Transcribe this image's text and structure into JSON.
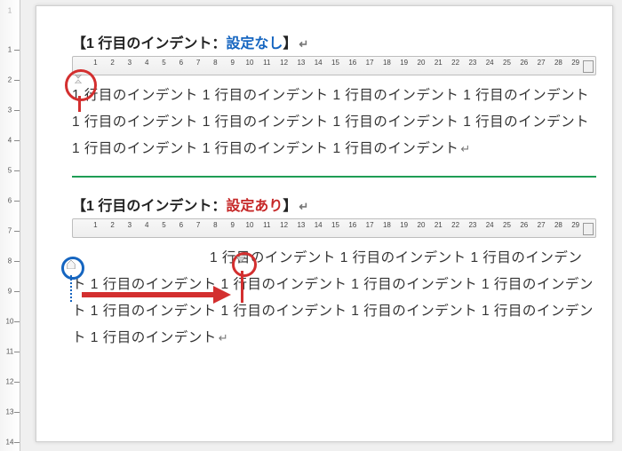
{
  "vertical_ruler": {
    "gray_label": "1",
    "max": 14,
    "spacing_px": 34
  },
  "hruler": {
    "max": 29,
    "spacing_px": 19.3
  },
  "sections": [
    {
      "id": "no-indent",
      "heading_pre": "【1 行目のインデント：",
      "heading_kw": "設定なし",
      "heading_kw_class": "kw-blue",
      "heading_post": "】",
      "return_mark": "↵",
      "body": "1 行目のインデント 1 行目のインデント 1 行目のインデント 1 行目のインデント 1 行目のインデント 1 行目のインデント 1 行目のインデント 1 行目のインデント 1 行目のインデント 1 行目のインデント 1 行目のインデント",
      "indented": false
    },
    {
      "id": "with-indent",
      "heading_pre": "【1 行目のインデント：",
      "heading_kw": "設定あり",
      "heading_kw_class": "kw-red",
      "heading_post": "】",
      "return_mark": "↵",
      "body": "1 行目のインデント 1 行目のインデント 1 行目のインデント 1 行目のインデント 1 行目のインデント 1 行目のインデント 1 行目のインデント 1 行目のインデント 1 行目のインデント 1 行目のインデント 1 行目のインデント 1 行目のインデント",
      "indented": true
    }
  ],
  "annotations": {
    "indent_position_chars": 10
  }
}
